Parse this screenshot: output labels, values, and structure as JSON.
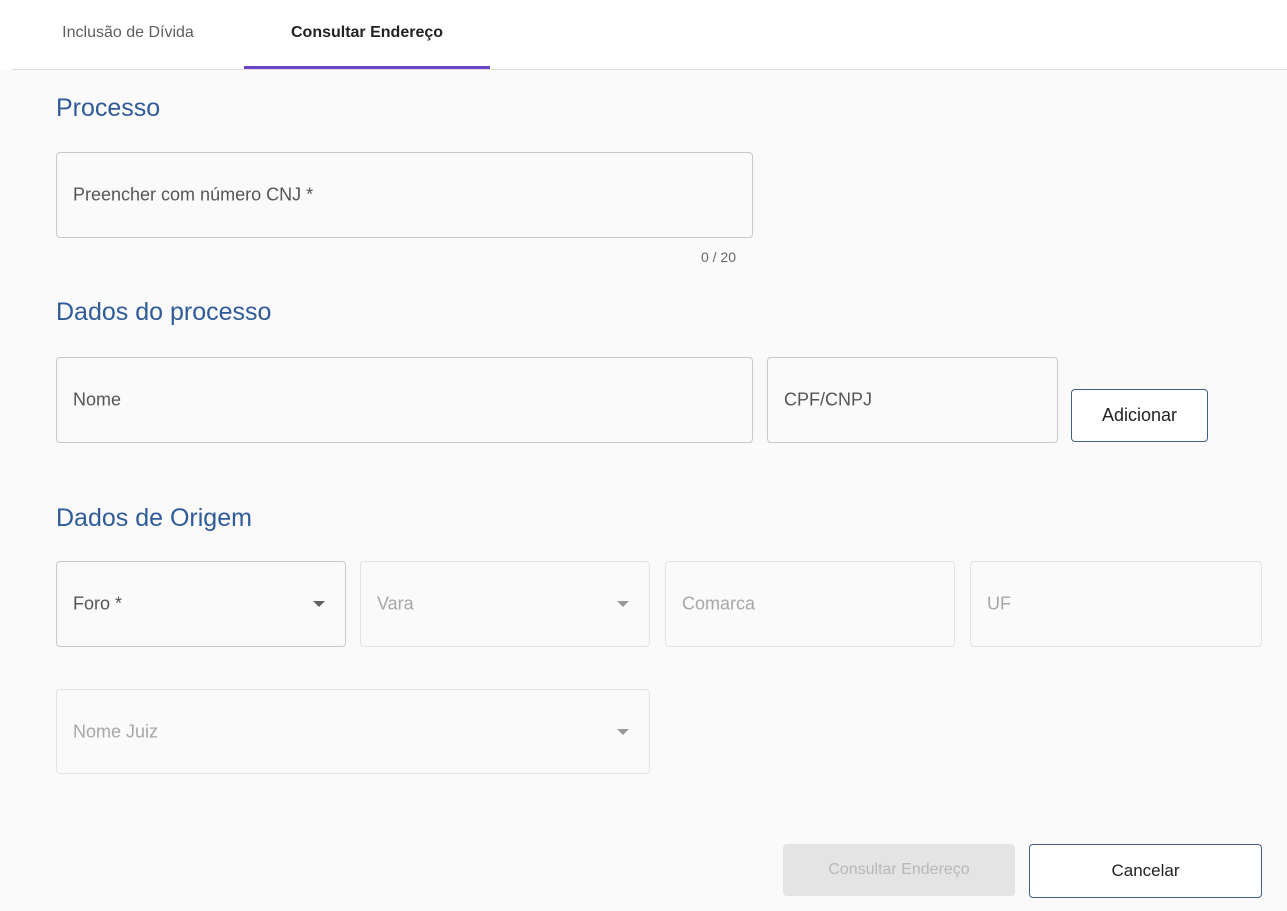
{
  "tabs": [
    {
      "label": "Inclusão de Dívida",
      "active": false
    },
    {
      "label": "Consultar Endereço",
      "active": true
    }
  ],
  "processo": {
    "title": "Processo",
    "cnj_field": {
      "label": "Preencher com número CNJ *",
      "value": ""
    },
    "counter": "0 / 20"
  },
  "dados_processo": {
    "title": "Dados do processo",
    "nome_field": {
      "label": "Nome",
      "value": ""
    },
    "cpf_field": {
      "label": "CPF/CNPJ",
      "value": ""
    },
    "add_button": "Adicionar"
  },
  "dados_origem": {
    "title": "Dados de Origem",
    "foro_select": {
      "label": "Foro *",
      "value": ""
    },
    "vara_select": {
      "label": "Vara",
      "value": ""
    },
    "comarca_field": {
      "label": "Comarca",
      "value": ""
    },
    "uf_field": {
      "label": "UF",
      "value": ""
    },
    "juiz_select": {
      "label": "Nome Juiz",
      "value": ""
    }
  },
  "actions": {
    "consultar_button": "Consultar Endereço",
    "cancelar_button": "Cancelar"
  },
  "colors": {
    "accent": "#6a45c8",
    "heading": "#2f5b9a",
    "button_border": "#3f5f8f"
  }
}
